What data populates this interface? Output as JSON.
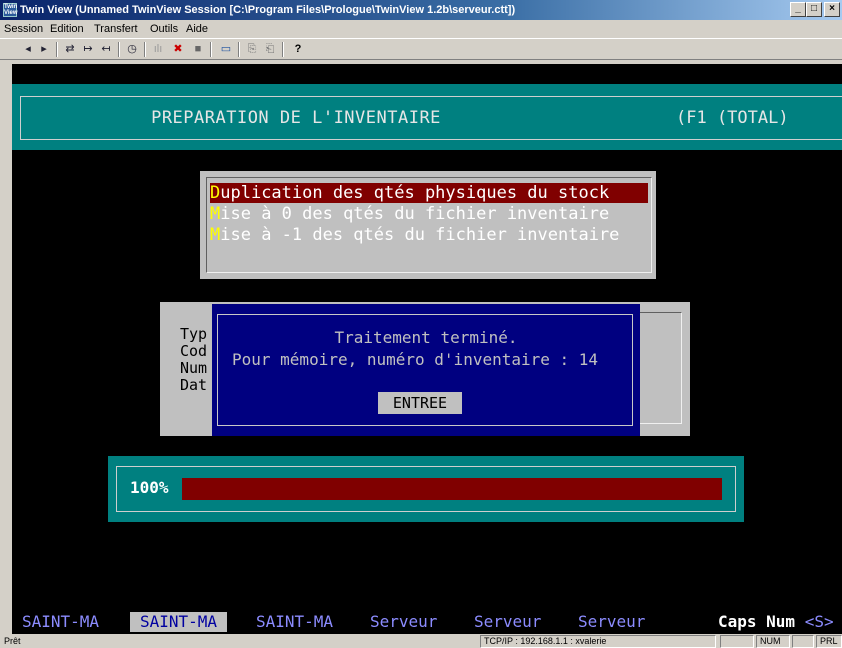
{
  "window": {
    "title": "Twin View (Unnamed TwinView Session [C:\\Program Files\\Prologue\\TwinView 1.2b\\serveur.ctt])",
    "icon_text": "Twin View",
    "buttons": {
      "minimize": "_",
      "maximize": "□",
      "close": "×"
    }
  },
  "menubar": [
    "Session",
    "Edition",
    "Transfert",
    "Outils",
    "Aide"
  ],
  "toolbar": {
    "icons": [
      "back-icon",
      "forward-icon",
      "connect-icon",
      "send-icon",
      "receive-icon",
      "clock-icon",
      "signal-icon",
      "disconnect-icon",
      "stop-icon",
      "screen-icon",
      "copy-icon",
      "paste-icon",
      "help-icon"
    ],
    "glyphs": [
      "◂",
      "▸",
      "⇄",
      "↦",
      "↤",
      "◷",
      "ılı",
      "✖",
      "■",
      "▭",
      "⎘",
      "⎗",
      "?"
    ]
  },
  "terminal": {
    "header_title": "PREPARATION DE L'INVENTAIRE",
    "header_mode": "(F1  (TOTAL)",
    "menu": [
      {
        "hotkey": "D",
        "rest": "uplication des qtés physiques du stock",
        "selected": true
      },
      {
        "hotkey": "M",
        "rest": "ise à  0 des qtés du fichier inventaire",
        "selected": false
      },
      {
        "hotkey": "M",
        "rest": "ise à -1 des qtés du fichier inventaire",
        "selected": false
      }
    ],
    "info_labels": [
      "Typ",
      "Cod",
      "Num",
      "Dat"
    ],
    "dialog": {
      "line1": "Traitement terminé.",
      "line2": "Pour mémoire, numéro d'inventaire : 14",
      "button": "ENTREE"
    },
    "progress": {
      "label": "100%",
      "value": 1.0
    },
    "status_segments": [
      {
        "text": "SAINT-MA",
        "active": false
      },
      {
        "text": "SAINT-MA",
        "active": true
      },
      {
        "text": "SAINT-MA",
        "active": false
      },
      {
        "text": "Serveur",
        "active": false
      },
      {
        "text": "Serveur",
        "active": false
      },
      {
        "text": "Serveur",
        "active": false
      }
    ],
    "caps_text": "Caps Num",
    "caps_suffix": "<S>"
  },
  "statusbar": {
    "ready": "Prêt",
    "connection": "TCP/IP : 192.168.1.1 : xvalerie",
    "num": "NUM",
    "prl": "PRL"
  },
  "colors": {
    "teal": "#008080",
    "dialog_blue": "#000080",
    "progress_red": "#800000",
    "hotkey_yellow": "#ffff00"
  }
}
